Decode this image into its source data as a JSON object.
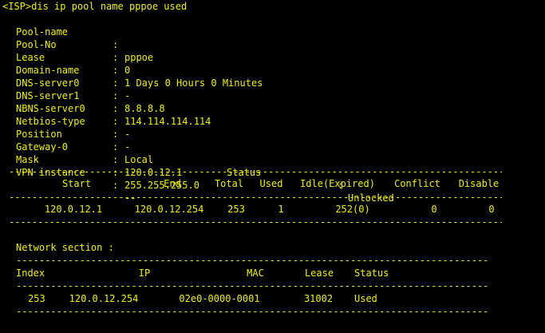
{
  "terminal": {
    "command": "<ISP>dis ip pool name pppoe used",
    "colon": ":",
    "fields": [
      {
        "key": "Pool-name",
        "value": "pppoe"
      },
      {
        "key": "Pool-No",
        "value": "0"
      },
      {
        "key": "Lease",
        "value": "1 Days 0 Hours 0 Minutes"
      },
      {
        "key": "Domain-name",
        "value": "-"
      },
      {
        "key": "DNS-server0",
        "value": "8.8.8.8"
      },
      {
        "key": "DNS-server1",
        "value": "114.114.114.114"
      },
      {
        "key": "NBNS-server0",
        "value": "-"
      },
      {
        "key": "Netbios-type",
        "value": "-"
      },
      {
        "key": "Position",
        "value": "Local"
      },
      {
        "key": "Gateway-0",
        "value": "120.0.12.1"
      },
      {
        "key": "Mask",
        "value": "255.255.255.0"
      },
      {
        "key": "VPN instance",
        "value": "--"
      }
    ],
    "status_label": "Status",
    "status_value": "Unlocked",
    "separator": "--------------------------------------------------------------------------------------------------------------------",
    "pool_table": {
      "headers": [
        "Start",
        "End",
        "Total",
        "Used",
        "Idle(Expired)",
        "Conflict",
        "Disable"
      ],
      "row": [
        "120.0.12.1",
        "120.0.12.254",
        "253",
        "1",
        "252(0)",
        "0",
        "0"
      ]
    },
    "network_section_label": "Network section :",
    "network_table": {
      "headers": [
        "Index",
        "IP",
        "MAC",
        "Lease",
        "Status"
      ],
      "row": [
        "253",
        "120.0.12.254",
        "02e0-0000-0001",
        "31002",
        "Used"
      ]
    },
    "colors": {
      "background": "#000000",
      "text": "#f0f000"
    }
  }
}
